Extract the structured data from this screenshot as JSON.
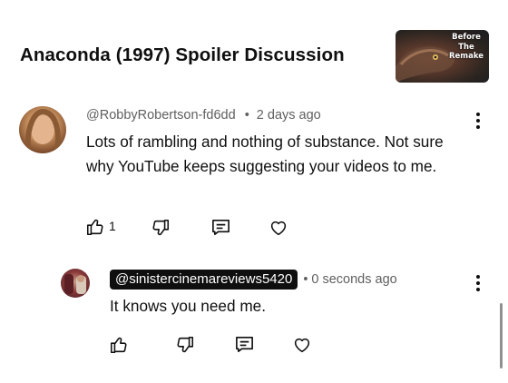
{
  "header": {
    "title": "Anaconda (1997) Spoiler Discussion",
    "thumbnail_text": [
      "Before",
      "The",
      "Remake"
    ]
  },
  "comments": [
    {
      "author": "@RobbyRobertson-fd6dd",
      "separator": "•",
      "time": "2 days ago",
      "text": "Lots of rambling and nothing of substance. Not sure why YouTube keeps suggesting your videos to me.",
      "like_count": "1",
      "icons": [
        "thumbs-up-icon",
        "thumbs-down-icon",
        "reply-icon",
        "heart-icon",
        "more-vert-icon"
      ]
    }
  ],
  "reply": {
    "author": "@sinistercinemareviews5420",
    "separator": "•",
    "time": "0 seconds ago",
    "text": "It knows you need me.",
    "icons": [
      "thumbs-up-icon",
      "thumbs-down-icon",
      "reply-icon",
      "heart-icon",
      "more-vert-icon"
    ]
  },
  "colors": {
    "text": "#0f0f0f",
    "meta": "#606060",
    "pill": "#0f0f0f"
  }
}
